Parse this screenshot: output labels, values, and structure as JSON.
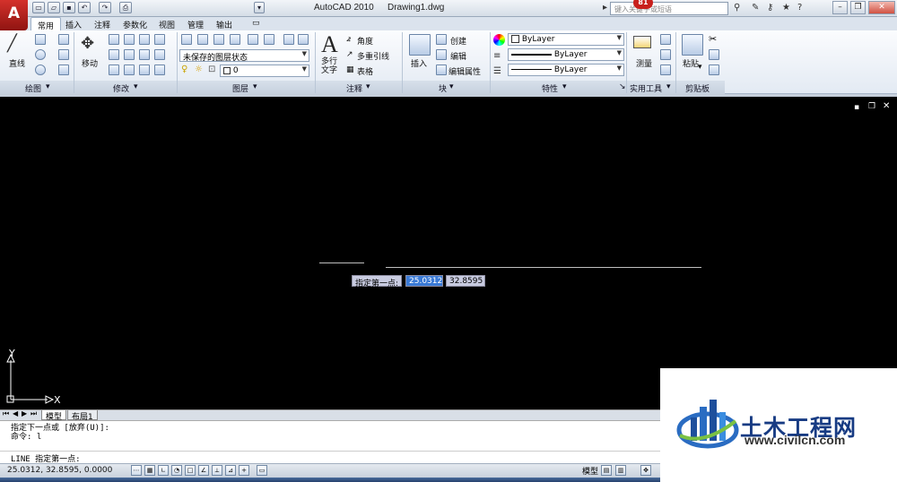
{
  "window": {
    "app_title": "AutoCAD 2010",
    "file_name": "Drawing1.dwg",
    "search_placeholder": "键入关键字或短语",
    "notification_count": "81"
  },
  "tabs": [
    "常用",
    "插入",
    "注释",
    "参数化",
    "视图",
    "管理",
    "输出"
  ],
  "ribbon": {
    "draw": {
      "line_label": "直线",
      "panel_label": "绘图"
    },
    "modify": {
      "move_label": "移动",
      "panel_label": "修改"
    },
    "layers": {
      "state_value": "未保存的图层状态",
      "layer_value": "0",
      "panel_label": "图层"
    },
    "annotation": {
      "mtext_label": "多行\n文字",
      "angle_label": "角度",
      "mleader_label": "多重引线",
      "table_label": "表格",
      "panel_label": "注释"
    },
    "block": {
      "insert_label": "插入",
      "create_label": "创建",
      "edit_label": "编辑",
      "attr_label": "编辑属性",
      "panel_label": "块"
    },
    "properties": {
      "color_value": "ByLayer",
      "linetype_value": "ByLayer",
      "lineweight_value": "ByLayer",
      "panel_label": "特性"
    },
    "utilities": {
      "measure_label": "测量",
      "panel_label": "实用工具"
    },
    "clipboard": {
      "paste_label": "粘贴",
      "panel_label": "剪贴板"
    }
  },
  "drawing": {
    "prompt_label": "指定第一点:",
    "x_value": "25.0312",
    "y_value": "32.8595",
    "ucs_x": "X",
    "ucs_y": "Y"
  },
  "layout_tabs": [
    "模型",
    "布局1"
  ],
  "command": {
    "history": [
      "指定下一点或 [放弃(U)]:",
      "命令: l"
    ],
    "current": "LINE 指定第一点:"
  },
  "status": {
    "coords": "25.0312, 32.8595, 0.0000",
    "model_label": "模型"
  },
  "watermark": {
    "title": "土木工程网",
    "url": "www.civilcn.com"
  },
  "colors": {
    "canvas": "#000000",
    "brand_blue": "#173b83",
    "accent_red": "#c8201c"
  }
}
